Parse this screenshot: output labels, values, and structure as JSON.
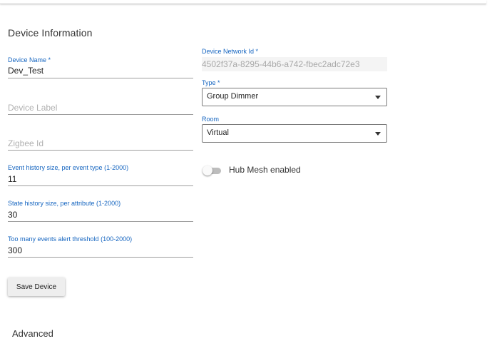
{
  "section": {
    "title": "Device Information"
  },
  "device_name": {
    "label": "Device Name *",
    "value": "Dev_Test"
  },
  "device_label": {
    "placeholder": "Device Label"
  },
  "zigbee_id": {
    "placeholder": "Zigbee Id"
  },
  "event_history": {
    "label": "Event history size, per event type (1-2000)",
    "value": "11"
  },
  "state_history": {
    "label": "State history size, per attribute (1-2000)",
    "value": "30"
  },
  "alert_threshold": {
    "label": "Too many events alert threshold (100-2000)",
    "value": "300"
  },
  "network_id": {
    "label": "Device Network Id *",
    "value": "4502f37a-8295-44b6-a742-fbec2adc72e3"
  },
  "type": {
    "label": "Type *",
    "value": "Group Dimmer"
  },
  "room": {
    "label": "Room",
    "value": "Virtual"
  },
  "hub_mesh": {
    "label": "Hub Mesh enabled",
    "enabled": false
  },
  "actions": {
    "save_label": "Save Device"
  },
  "advanced": {
    "title": "Advanced"
  }
}
